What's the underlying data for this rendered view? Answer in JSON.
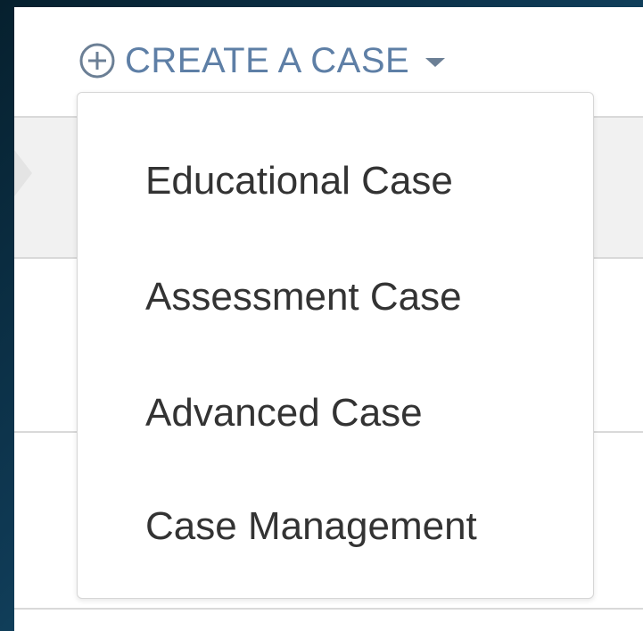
{
  "header": {
    "create_case_label": "CREATE A CASE",
    "plus_icon": "plus-circle-icon",
    "caret_icon": "caret-down-icon"
  },
  "dropdown": {
    "items": [
      {
        "label": "Educational Case"
      },
      {
        "label": "Assessment Case"
      },
      {
        "label": "Advanced Case"
      },
      {
        "label": "Case Management"
      }
    ]
  },
  "colors": {
    "accent": "#5e7fa6",
    "menu_text": "#333333",
    "backdrop": "#0f3a55"
  }
}
